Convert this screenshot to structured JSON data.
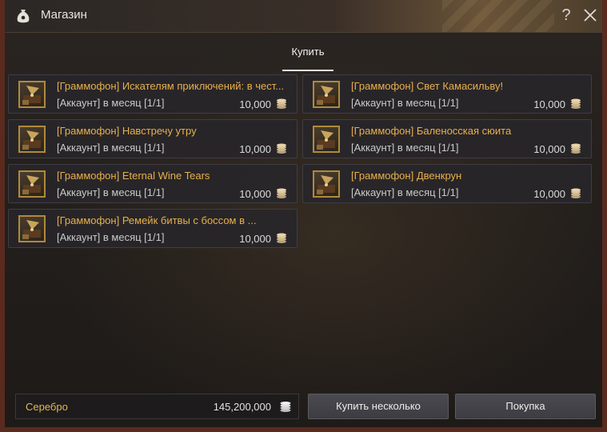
{
  "window": {
    "title": "Магазин"
  },
  "tabs": {
    "buy_label": "Купить"
  },
  "items": [
    {
      "name": "[Граммофон] Искателям приключений: в чест...",
      "limit": "[Аккаунт] в месяц [1/1]",
      "price": "10,000"
    },
    {
      "name": "[Граммофон] Свет Камасильву!",
      "limit": "[Аккаунт] в месяц [1/1]",
      "price": "10,000"
    },
    {
      "name": "[Граммофон] Навстречу утру",
      "limit": "[Аккаунт] в месяц [1/1]",
      "price": "10,000"
    },
    {
      "name": "[Граммофон] Баленосская сюита",
      "limit": "[Аккаунт] в месяц [1/1]",
      "price": "10,000"
    },
    {
      "name": "[Граммофон] Eternal Wine Tears",
      "limit": "[Аккаунт] в месяц [1/1]",
      "price": "10,000"
    },
    {
      "name": "[Граммофон] Двенкрун",
      "limit": "[Аккаунт] в месяц [1/1]",
      "price": "10,000"
    },
    {
      "name": "[Граммофон] Ремейк битвы с боссом в ...",
      "limit": "[Аккаунт] в месяц [1/1]",
      "price": "10,000"
    }
  ],
  "footer": {
    "currency_label": "Серебро",
    "currency_value": "145,200,000",
    "buy_multiple_label": "Купить несколько",
    "purchase_label": "Покупка"
  },
  "icons": {
    "window_icon": "money-bag-icon",
    "help": "help-icon",
    "close": "close-icon",
    "item_thumb": "gramophone-icon",
    "currency": "silver-coin-stack-icon"
  },
  "colors": {
    "item_name": "#e8b04a",
    "currency_label": "#e6b656",
    "window_border": "#5a2a1e"
  }
}
